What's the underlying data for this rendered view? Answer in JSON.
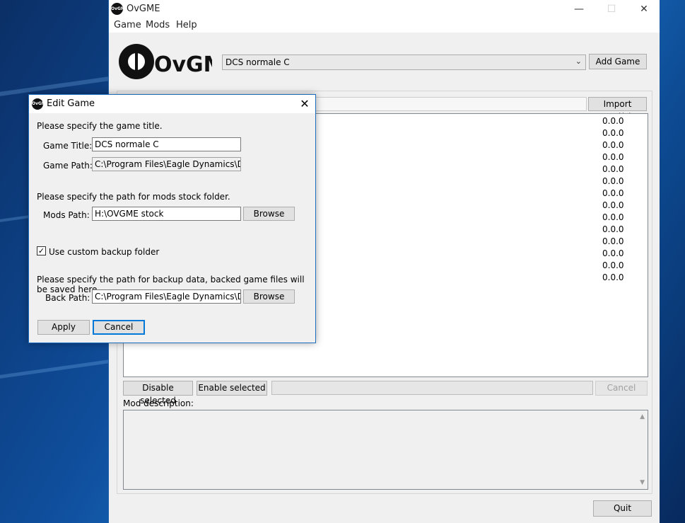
{
  "window": {
    "title": "OvGME",
    "icon_text": "OvGME",
    "controls": [
      "—",
      "☐",
      "✕"
    ]
  },
  "menu": [
    "Game",
    "Mods",
    "Help"
  ],
  "logo_text": "OvGME",
  "game_select": {
    "value": "DCS normale C"
  },
  "buttons": {
    "add_game": "Add Game",
    "import_mods": "Import Mod(s)",
    "disable_selected": "Disable selected",
    "enable_selected": "Enable selected",
    "cancel": "Cancel",
    "quit": "Quit"
  },
  "mod_versions": [
    "0.0.0",
    "0.0.0",
    "0.0.0",
    "0.0.0",
    "0.0.0",
    "0.0.0",
    "0.0.0",
    "0.0.0",
    "0.0.0",
    "0.0.0",
    "0.0.0",
    "0.0.0",
    "0.0.0",
    "0.0.0"
  ],
  "mod_description_label": "Mod description:",
  "dialog": {
    "title": "Edit Game",
    "intro_title": "Please specify the game title.",
    "game_title_label": "Game Title:",
    "game_title_value": "DCS normale C",
    "game_path_label": "Game Path:",
    "game_path_value": "C:\\Program Files\\Eagle Dynamics\\DCS Wc",
    "intro_mods": "Please specify the path for mods stock folder.",
    "mods_path_label": "Mods Path:",
    "mods_path_value": "H:\\OVGME stock",
    "browse_label": "Browse",
    "backup_checkbox_label": "Use custom backup folder",
    "backup_checked": true,
    "intro_backup": "Please specify the path for backup data, backed game files will be saved here.",
    "back_path_label": "Back Path:",
    "back_path_value": "C:\\Program Files\\Eagle Dynamics\\DCS Wc",
    "apply_label": "Apply",
    "cancel_label": "Cancel"
  }
}
